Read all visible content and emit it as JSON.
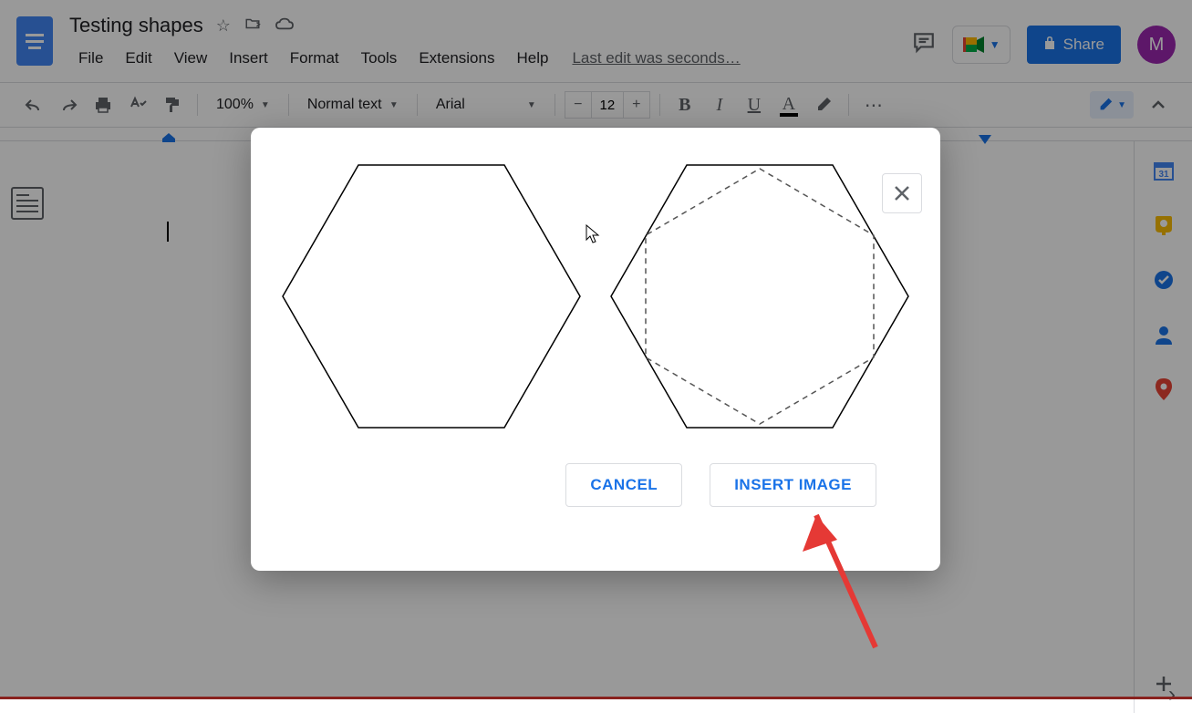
{
  "document": {
    "title": "Testing shapes",
    "star_state": false
  },
  "menu": {
    "file": "File",
    "edit": "Edit",
    "view": "View",
    "insert": "Insert",
    "format": "Format",
    "tools": "Tools",
    "extensions": "Extensions",
    "help": "Help",
    "last_edit": "Last edit was seconds…"
  },
  "toolbar": {
    "zoom": "100%",
    "style": "Normal text",
    "font": "Arial",
    "font_size": "12"
  },
  "share": {
    "label": "Share"
  },
  "avatar": {
    "initial": "M"
  },
  "modal": {
    "cancel": "CANCEL",
    "insert": "INSERT IMAGE"
  },
  "side_panel": {
    "calendar_day": "31"
  }
}
